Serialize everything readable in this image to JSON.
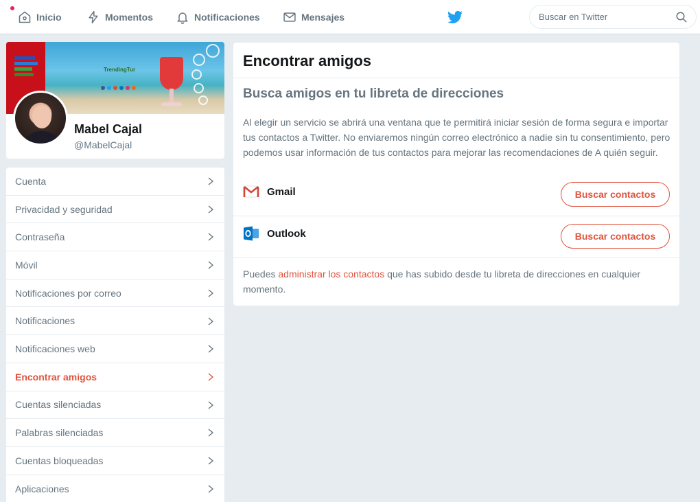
{
  "nav": {
    "home": "Inicio",
    "moments": "Momentos",
    "notifications": "Notificaciones",
    "messages": "Mensajes",
    "search_placeholder": "Buscar en Twitter"
  },
  "colors": {
    "accent": "#e0533d",
    "twitter_blue": "#1da1f2",
    "background": "#e6ecf0",
    "muted_text": "#66757f"
  },
  "profile": {
    "name": "Mabel Cajal",
    "handle": "@MabelCajal",
    "banner_text": "TrendingTur"
  },
  "menu": {
    "items": [
      {
        "label": "Cuenta",
        "active": false
      },
      {
        "label": "Privacidad y seguridad",
        "active": false
      },
      {
        "label": "Contraseña",
        "active": false
      },
      {
        "label": "Móvil",
        "active": false
      },
      {
        "label": "Notificaciones por correo",
        "active": false
      },
      {
        "label": "Notificaciones",
        "active": false
      },
      {
        "label": "Notificaciones web",
        "active": false
      },
      {
        "label": "Encontrar amigos",
        "active": true
      },
      {
        "label": "Cuentas silenciadas",
        "active": false
      },
      {
        "label": "Palabras silenciadas",
        "active": false
      },
      {
        "label": "Cuentas bloqueadas",
        "active": false
      },
      {
        "label": "Aplicaciones",
        "active": false
      }
    ]
  },
  "main": {
    "title": "Encontrar amigos",
    "subtitle": "Busca amigos en tu libreta de direcciones",
    "description": "Al elegir un servicio se abrirá una ventana que te permitirá iniciar sesión de forma segura e importar tus contactos a Twitter. No enviaremos ningún correo electrónico a nadie sin tu consentimiento, pero podemos usar información de tus contactos para mejorar las recomendaciones de A quién seguir.",
    "services": [
      {
        "name": "Gmail",
        "icon": "gmail-icon",
        "button": "Buscar contactos"
      },
      {
        "name": "Outlook",
        "icon": "outlook-icon",
        "button": "Buscar contactos"
      }
    ],
    "footer": {
      "before": "Puedes ",
      "link": "administrar los contactos",
      "after": " que has subido desde tu libreta de direcciones en cualquier momento."
    }
  }
}
